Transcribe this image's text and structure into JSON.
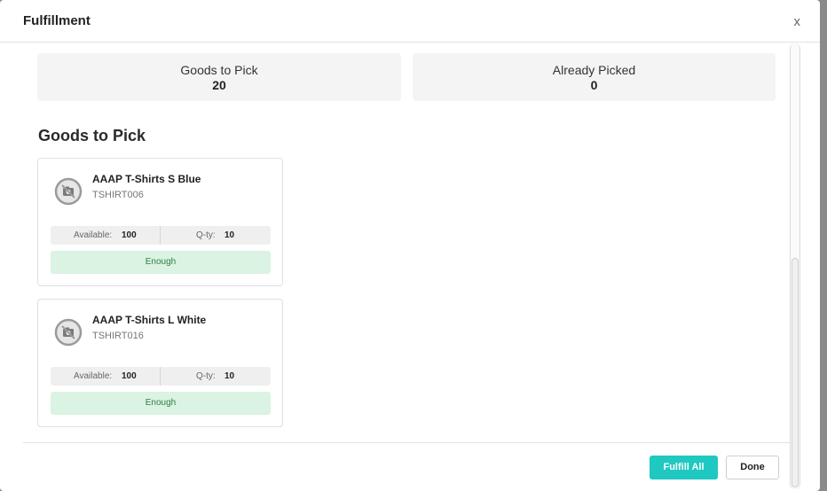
{
  "modal": {
    "title": "Fulfillment",
    "close_label": "x"
  },
  "stats": [
    {
      "label": "Goods to Pick",
      "value": "20"
    },
    {
      "label": "Already Picked",
      "value": "0"
    }
  ],
  "section": {
    "title": "Goods to Pick"
  },
  "items": [
    {
      "name": "AAAP T-Shirts S Blue",
      "sku": "TSHIRT006",
      "available_label": "Available:",
      "available_value": "100",
      "qty_label": "Q-ty:",
      "qty_value": "10",
      "status": "Enough",
      "image_icon": "no-image-icon"
    },
    {
      "name": "AAAP T-Shirts L White",
      "sku": "TSHIRT016",
      "available_label": "Available:",
      "available_value": "100",
      "qty_label": "Q-ty:",
      "qty_value": "10",
      "status": "Enough",
      "image_icon": "no-image-icon"
    }
  ],
  "footer": {
    "fulfill_all_label": "Fulfill All",
    "done_label": "Done"
  },
  "colors": {
    "accent": "#1fc8c1",
    "status_bg": "#daf3e2",
    "status_text": "#2e7d46"
  }
}
